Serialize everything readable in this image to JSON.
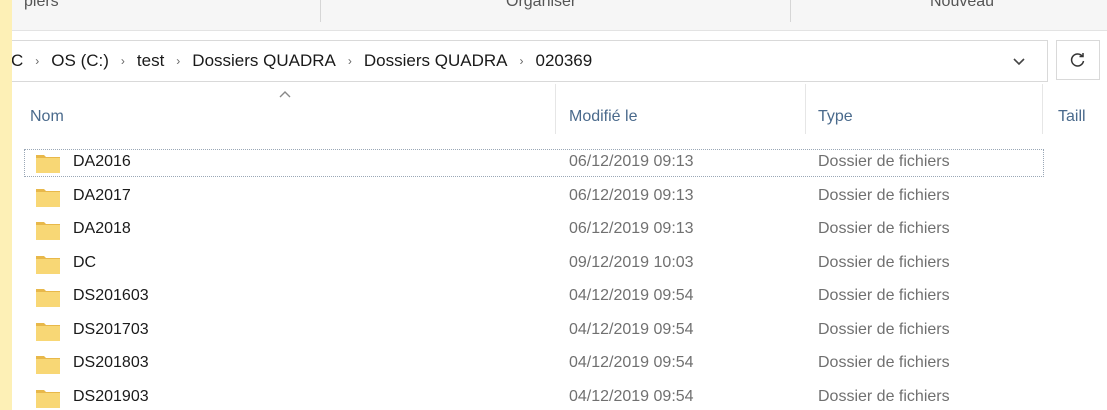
{
  "ribbon": {
    "groups": [
      "piers",
      "Organiser",
      "Nouveau"
    ]
  },
  "address_bar": {
    "crumbs": [
      "C",
      "OS (C:)",
      "test",
      "Dossiers QUADRA",
      "Dossiers QUADRA",
      "020369"
    ],
    "separator": "›",
    "dropdown_icon": "chevron-down-icon",
    "refresh_icon": "refresh-icon"
  },
  "columns": {
    "name": "Nom",
    "modified": "Modifié le",
    "type": "Type",
    "size": "Taill"
  },
  "files": [
    {
      "name": "DA2016",
      "modified": "06/12/2019 09:13",
      "type": "Dossier de fichiers",
      "icon": "folder-icon",
      "selected": true
    },
    {
      "name": "DA2017",
      "modified": "06/12/2019 09:13",
      "type": "Dossier de fichiers",
      "icon": "folder-icon"
    },
    {
      "name": "DA2018",
      "modified": "06/12/2019 09:13",
      "type": "Dossier de fichiers",
      "icon": "folder-icon"
    },
    {
      "name": "DC",
      "modified": "09/12/2019 10:03",
      "type": "Dossier de fichiers",
      "icon": "folder-icon"
    },
    {
      "name": "DS201603",
      "modified": "04/12/2019 09:54",
      "type": "Dossier de fichiers",
      "icon": "folder-icon"
    },
    {
      "name": "DS201703",
      "modified": "04/12/2019 09:54",
      "type": "Dossier de fichiers",
      "icon": "folder-icon"
    },
    {
      "name": "DS201803",
      "modified": "04/12/2019 09:54",
      "type": "Dossier de fichiers",
      "icon": "folder-icon"
    },
    {
      "name": "DS201903",
      "modified": "04/12/2019 09:54",
      "type": "Dossier de fichiers",
      "icon": "folder-icon"
    }
  ],
  "colors": {
    "background_border": "#fdf0b6",
    "folder_fill": "#f8d775",
    "folder_tab": "#e8b84a",
    "header_text": "#4a6a8c"
  }
}
